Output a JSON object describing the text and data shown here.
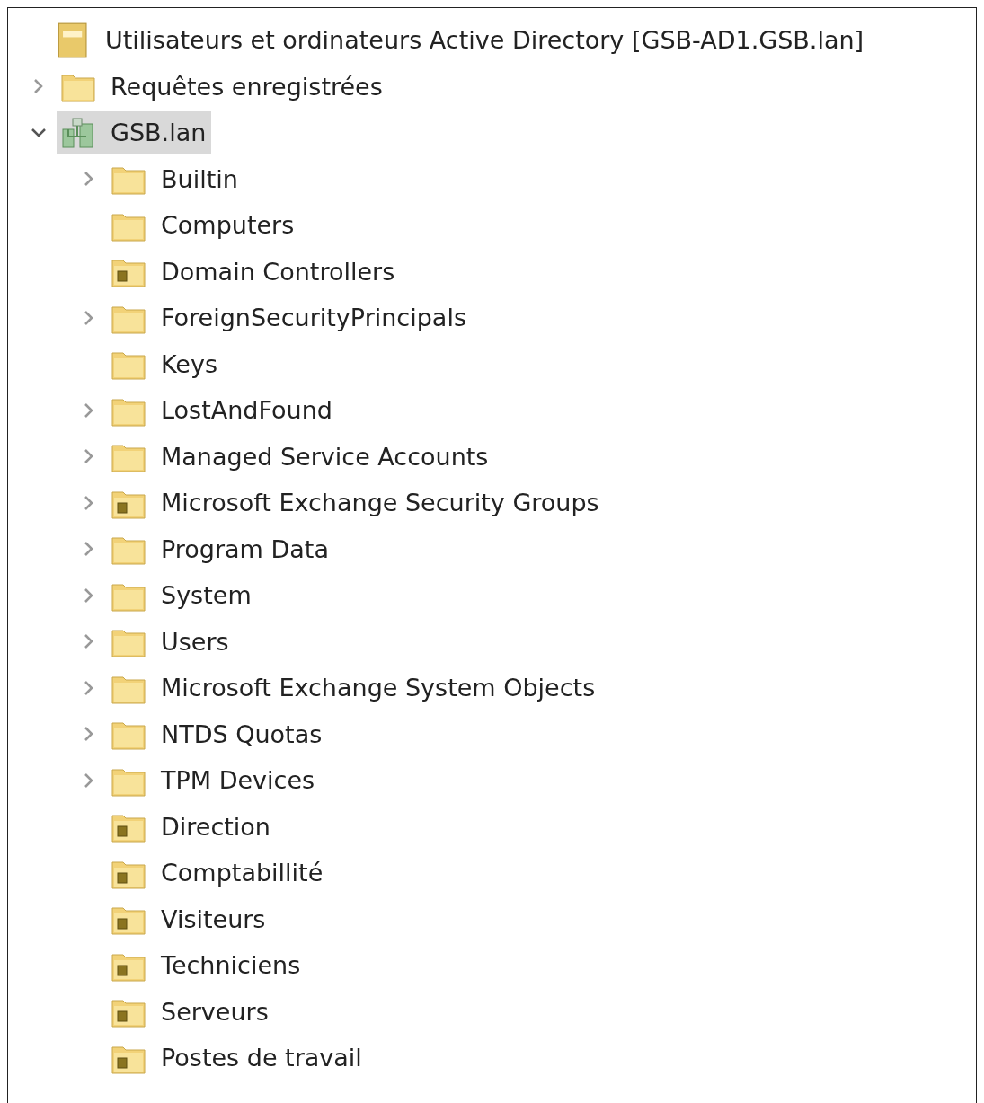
{
  "tree": {
    "label": "Utilisateurs et ordinateurs Active Directory [GSB-AD1.GSB.lan]",
    "kind": "console",
    "children": [
      {
        "label": "Requêtes enregistrées",
        "kind": "folder",
        "expandable": true,
        "expanded": false,
        "selected": false
      },
      {
        "label": "GSB.lan",
        "kind": "domain",
        "expandable": true,
        "expanded": true,
        "selected": true,
        "children": [
          {
            "label": "Builtin",
            "kind": "folder",
            "expandable": true,
            "expanded": false,
            "selected": false
          },
          {
            "label": "Computers",
            "kind": "folder",
            "expandable": false,
            "selected": false
          },
          {
            "label": "Domain Controllers",
            "kind": "ou",
            "expandable": false,
            "selected": false
          },
          {
            "label": "ForeignSecurityPrincipals",
            "kind": "folder",
            "expandable": true,
            "expanded": false,
            "selected": false
          },
          {
            "label": "Keys",
            "kind": "folder",
            "expandable": false,
            "selected": false
          },
          {
            "label": "LostAndFound",
            "kind": "folder",
            "expandable": true,
            "expanded": false,
            "selected": false
          },
          {
            "label": "Managed Service Accounts",
            "kind": "folder",
            "expandable": true,
            "expanded": false,
            "selected": false
          },
          {
            "label": "Microsoft Exchange Security Groups",
            "kind": "ou",
            "expandable": true,
            "expanded": false,
            "selected": false
          },
          {
            "label": "Program Data",
            "kind": "folder",
            "expandable": true,
            "expanded": false,
            "selected": false
          },
          {
            "label": "System",
            "kind": "folder",
            "expandable": true,
            "expanded": false,
            "selected": false
          },
          {
            "label": "Users",
            "kind": "folder",
            "expandable": true,
            "expanded": false,
            "selected": false
          },
          {
            "label": "Microsoft Exchange System Objects",
            "kind": "folder",
            "expandable": true,
            "expanded": false,
            "selected": false
          },
          {
            "label": "NTDS Quotas",
            "kind": "folder",
            "expandable": true,
            "expanded": false,
            "selected": false
          },
          {
            "label": "TPM Devices",
            "kind": "folder",
            "expandable": true,
            "expanded": false,
            "selected": false
          },
          {
            "label": "Direction",
            "kind": "ou",
            "expandable": false,
            "selected": false
          },
          {
            "label": "Comptabillité",
            "kind": "ou",
            "expandable": false,
            "selected": false
          },
          {
            "label": "Visiteurs",
            "kind": "ou",
            "expandable": false,
            "selected": false
          },
          {
            "label": "Techniciens",
            "kind": "ou",
            "expandable": false,
            "selected": false
          },
          {
            "label": "Serveurs",
            "kind": "ou",
            "expandable": false,
            "selected": false
          },
          {
            "label": "Postes de travail",
            "kind": "ou",
            "expandable": false,
            "selected": false
          }
        ]
      }
    ]
  }
}
